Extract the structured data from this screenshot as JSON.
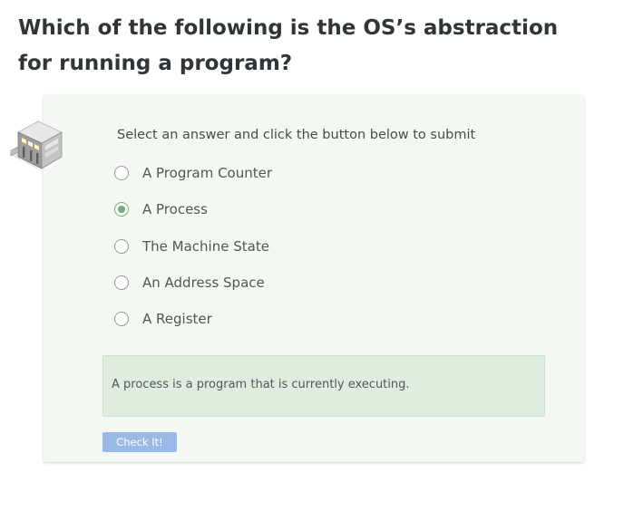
{
  "question": {
    "title": "Which of the following is the OS’s abstraction for running a program?"
  },
  "quiz": {
    "icon": "isometric-building-icon",
    "instruction": "Select an answer and click the button below to submit",
    "options": [
      {
        "label": "A Program Counter",
        "selected": false
      },
      {
        "label": "A Process",
        "selected": true
      },
      {
        "label": "The Machine State",
        "selected": false
      },
      {
        "label": "An Address Space",
        "selected": false
      },
      {
        "label": "A Register",
        "selected": false
      }
    ],
    "feedback": "A process is a program that is currently executing.",
    "submit_label": "Check It!"
  },
  "colors": {
    "card_background": "#f3f8f3",
    "feedback_background": "#e1ece0",
    "selected_radio": "#6fae7a",
    "button_background": "#9ab9e6"
  }
}
